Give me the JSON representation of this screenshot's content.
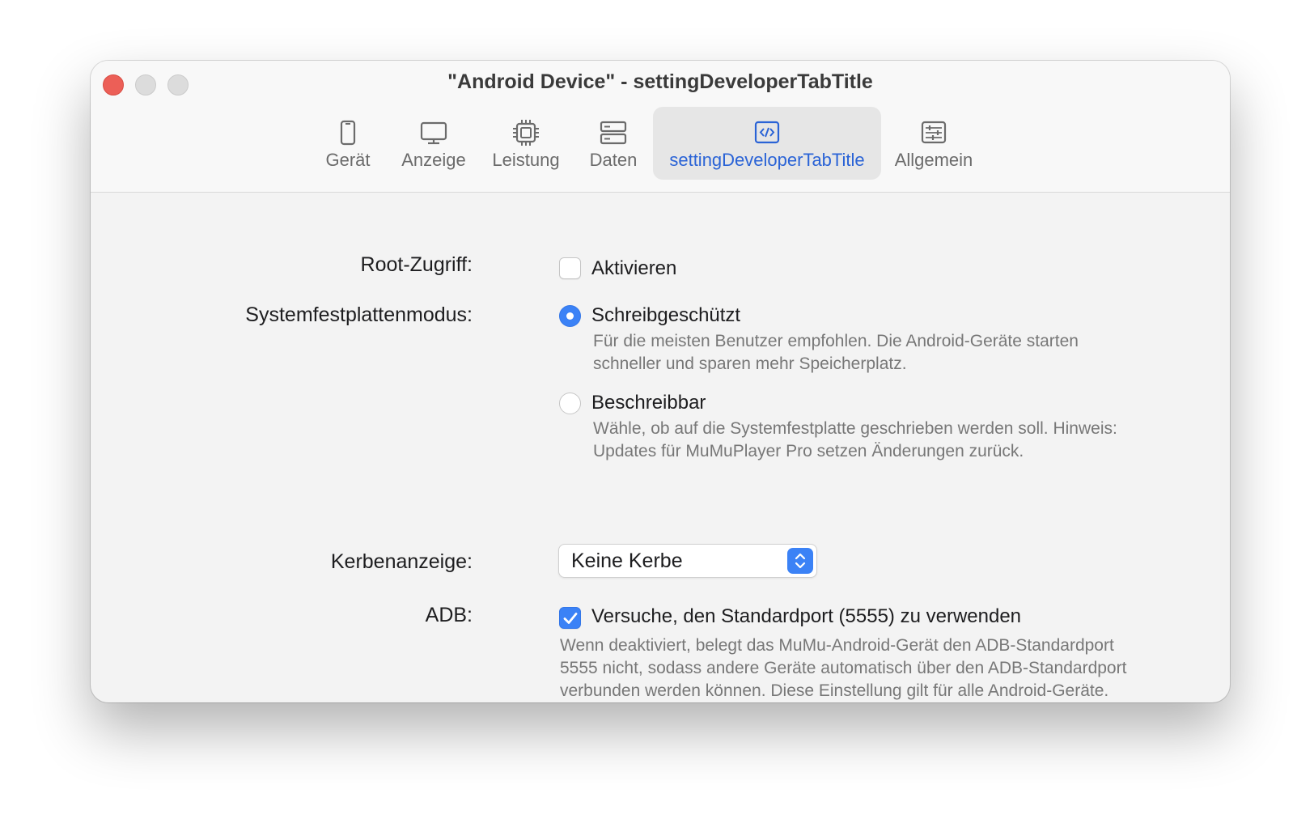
{
  "window": {
    "title": "\"Android Device\" - settingDeveloperTabTitle"
  },
  "tabs": [
    {
      "label": "Gerät",
      "icon": "phone-icon",
      "selected": false
    },
    {
      "label": "Anzeige",
      "icon": "monitor-icon",
      "selected": false
    },
    {
      "label": "Leistung",
      "icon": "cpu-icon",
      "selected": false
    },
    {
      "label": "Daten",
      "icon": "storage-icon",
      "selected": false
    },
    {
      "label": "settingDeveloperTabTitle",
      "icon": "developer-code-icon",
      "selected": true
    },
    {
      "label": "Allgemein",
      "icon": "sliders-icon",
      "selected": false
    }
  ],
  "settings": {
    "root": {
      "label": "Root-Zugriff:",
      "checkbox_label": "Aktivieren",
      "checked": false
    },
    "disk_mode": {
      "label": "Systemfestplattenmodus:",
      "options": [
        {
          "label": "Schreibgeschützt",
          "desc_line1": "Für die meisten Benutzer empfohlen. Die Android-Geräte starten",
          "desc_line2": "schneller und sparen mehr Speicherplatz.",
          "selected": true
        },
        {
          "label": "Beschreibbar",
          "desc_line1": "Wähle, ob auf die Systemfestplatte geschrieben werden soll. Hinweis:",
          "desc_line2": "Updates für MuMuPlayer Pro setzen Änderungen zurück.",
          "selected": false
        }
      ]
    },
    "notch": {
      "label": "Kerbenanzeige:",
      "value": "Keine Kerbe"
    },
    "adb": {
      "label": "ADB:",
      "checkbox_label": "Versuche, den Standardport (5555) zu verwenden",
      "checked": true,
      "desc_line1": "Wenn deaktiviert, belegt das MuMu-Android-Gerät den ADB-Standardport",
      "desc_line2": "5555 nicht, sodass andere Geräte automatisch über den ADB-Standardport",
      "desc_line3": "verbunden werden können. Diese Einstellung gilt für alle Android-Geräte."
    }
  },
  "colors": {
    "accent": "#3b82f6",
    "selected_tab_text": "#2a63d6",
    "close_button": "#ec5f57"
  }
}
